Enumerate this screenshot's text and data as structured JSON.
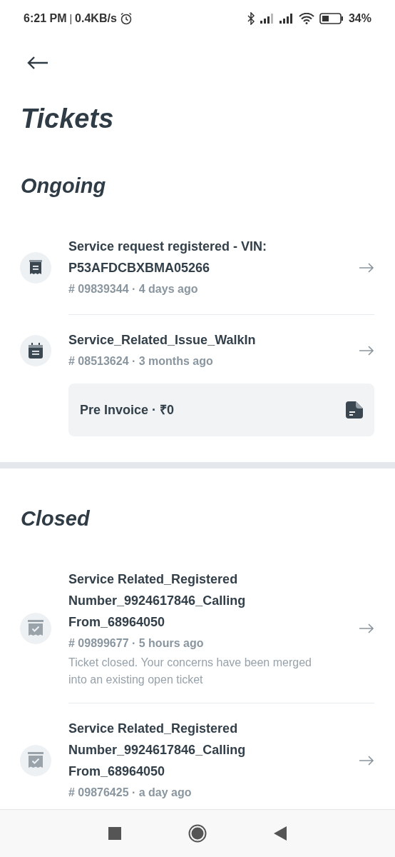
{
  "status_bar": {
    "time": "6:21 PM",
    "separator": "|",
    "speed": "0.4KB/s",
    "battery": "34%"
  },
  "page": {
    "title": "Tickets"
  },
  "sections": [
    {
      "heading": "Ongoing",
      "items": [
        {
          "kind": "receipt",
          "title": "Service request registered - VIN: P53AFDCBXBMA05266",
          "meta": "# 09839344 · 4 days ago"
        },
        {
          "kind": "calendar",
          "title": "Service_Related_Issue_WalkIn",
          "meta": "# 08513624 · 3 months ago",
          "invoice": "Pre Invoice · ₹0"
        }
      ]
    },
    {
      "heading": "Closed",
      "items": [
        {
          "kind": "archive",
          "title": "Service Related_Registered Number_9924617846_Calling From_68964050",
          "meta": "# 09899677 · 5 hours ago",
          "description": "Ticket closed. Your concerns have been merged into an existing open ticket"
        },
        {
          "kind": "archive",
          "title": "Service Related_Registered Number_9924617846_Calling From_68964050",
          "meta": "# 09876425 · a day ago"
        }
      ]
    }
  ]
}
